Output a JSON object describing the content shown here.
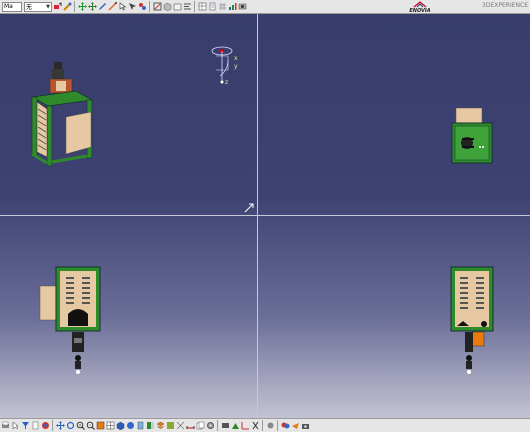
{
  "toolbar_top": {
    "select_1": "Ma",
    "select_2": "无",
    "logo_text": "ENOVIA",
    "top_right_text": "3DEXPERIENCE"
  },
  "compass": {
    "x_label": "x",
    "y_label": "y",
    "z_label": "z"
  },
  "colors": {
    "viewport_top": "#383d6c",
    "viewport_bottom": "#c4c3d4",
    "frame_green": "#2f8a2a",
    "panel_tan": "#e6c9a2",
    "divider": "#c8c8d8"
  },
  "icons_top": [
    "paint-icon",
    "brush-icon",
    "move-icon",
    "rotate-icon",
    "edit-icon",
    "measure-icon",
    "arrow-icon",
    "pointer-icon",
    "parts-icon",
    "sketch-icon",
    "cube-icon",
    "box-icon",
    "align-icon",
    "table-icon",
    "sheet-icon",
    "grid-icon",
    "analysis-icon",
    "capture-icon"
  ],
  "icons_bottom": [
    "print-icon",
    "cursor-icon",
    "filter-icon",
    "sheet-icon",
    "color-icon",
    "pan-icon",
    "rotate-icon",
    "zoom-in-icon",
    "zoom-out-icon",
    "normal-view-icon",
    "multi-view-icon",
    "iso-view-icon",
    "shading-icon",
    "hide-show-icon",
    "swap-icon",
    "layer-icon",
    "render-icon",
    "wire-icon",
    "measure-icon",
    "copy-icon",
    "settings-icon",
    "view-icon",
    "scene-icon",
    "axis-icon",
    "cut-icon",
    "material-icon",
    "walk-icon",
    "fly-icon",
    "camera-icon"
  ]
}
